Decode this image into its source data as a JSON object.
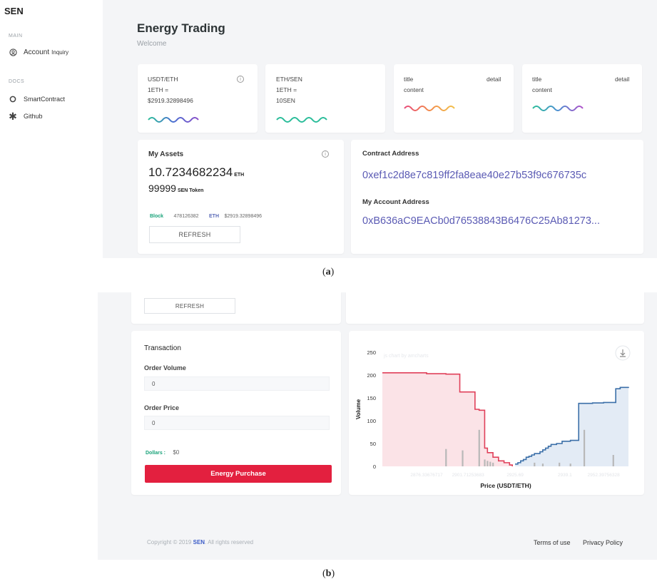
{
  "brand": "SEN",
  "sidebar": {
    "main_label": "MAIN",
    "account_main": "Account",
    "account_sub": "Inquiry",
    "docs_label": "DOCS",
    "smart_contract": "SmartContract",
    "github": "Github"
  },
  "header": {
    "title": "Energy Trading",
    "subtitle": "Welcome"
  },
  "stats": [
    {
      "label": "USDT/ETH",
      "line1": "1ETH =",
      "line2": "$2919.32898496",
      "wave_colors": [
        "#2bbd9a",
        "#4a6fd1",
        "#8a4fc9"
      ]
    },
    {
      "label": "ETH/SEN",
      "line1": "1ETH =",
      "line2": "10SEN",
      "wave_colors": [
        "#2bbd9a",
        "#2bbd9a",
        "#2bbd9a"
      ]
    },
    {
      "label": "title",
      "detail": "detail",
      "line1": "content",
      "wave_colors": [
        "#e84a7a",
        "#f28a4a",
        "#f2c14a"
      ]
    },
    {
      "label": "title",
      "detail": "detail",
      "line1": "content",
      "wave_colors": [
        "#2bbd9a",
        "#4a8fd1",
        "#b04fc9"
      ]
    }
  ],
  "assets": {
    "title": "My Assets",
    "eth_amount": "10.7234682234",
    "eth_unit": "ETH",
    "sen_amount": "99999",
    "sen_unit": "SEN Token",
    "block_label": "Block",
    "block_value": "478126382",
    "eth_label": "ETH",
    "eth_value": "$2919.32898496",
    "refresh": "REFRESH"
  },
  "addresses": {
    "contract_label": "Contract Address",
    "contract": "0xef1c2d8e7c819ff2fa8eae40e27b53f9c676735c",
    "account_label": "My Account Address",
    "account": "0xB636aC9EACb0d76538843B6476C25Ab81273..."
  },
  "captions": {
    "a": "a",
    "b": "b"
  },
  "transaction": {
    "refresh": "REFRESH",
    "title": "Transaction",
    "order_volume_label": "Order Volume",
    "order_volume": "0",
    "order_price_label": "Order Price",
    "order_price": "0",
    "dollars_label": "Dollars :",
    "dollars_value": "$0",
    "purchase": "Energy Purchase"
  },
  "footer": {
    "copyright_prefix": "Copyright © 2019 ",
    "copyright_brand": "SEN",
    "copyright_suffix": ". All rights reserved",
    "terms": "Terms of use",
    "privacy": "Privacy Policy"
  },
  "chart_data": {
    "type": "area",
    "watermark": "js chart by amcharts",
    "xlabel": "Price (USDT/ETH)",
    "ylabel": "Volume",
    "ylim": [
      0,
      250
    ],
    "y_ticks": [
      0,
      50,
      100,
      150,
      200,
      250
    ],
    "x_tick_labels": [
      "2876.33676717",
      "2901.71253683",
      "2925.69",
      "2939.1",
      "2952.39756328"
    ],
    "colors": {
      "bids": "#e0405a",
      "bids_fill": "#fbe3e7",
      "asks": "#3b6fa8",
      "asks_fill": "#e3ebf5",
      "volume_bars": "#b8b8b8"
    },
    "series": [
      {
        "name": "bids",
        "x": [
          2868,
          2876,
          2884,
          2891,
          2896,
          2899,
          2901.5,
          2903,
          2905,
          2906,
          2908,
          2910,
          2912,
          2914,
          2915
        ],
        "y": [
          205,
          205,
          203,
          202,
          163,
          163,
          125,
          123,
          40,
          30,
          20,
          12,
          8,
          3,
          0
        ]
      },
      {
        "name": "asks",
        "x": [
          2916,
          2917,
          2918,
          2919,
          2920,
          2921,
          2922,
          2923,
          2924,
          2925,
          2926,
          2927,
          2928,
          2929,
          2931,
          2933,
          2936,
          2939,
          2942,
          2944,
          2948,
          2952.4,
          2954,
          2957
        ],
        "y": [
          5,
          8,
          12,
          15,
          20,
          22,
          25,
          28,
          28,
          32,
          36,
          40,
          44,
          48,
          50,
          55,
          57,
          138,
          138,
          139,
          140,
          170,
          173,
          174
        ]
      }
    ],
    "volume_bars": {
      "x": [
        2891,
        2897,
        2903,
        2905,
        2906,
        2907,
        2908,
        2923,
        2926,
        2932,
        2936,
        2941,
        2951.5
      ],
      "y": [
        38,
        35,
        80,
        15,
        12,
        10,
        8,
        8,
        6,
        8,
        6,
        80,
        25
      ]
    }
  }
}
